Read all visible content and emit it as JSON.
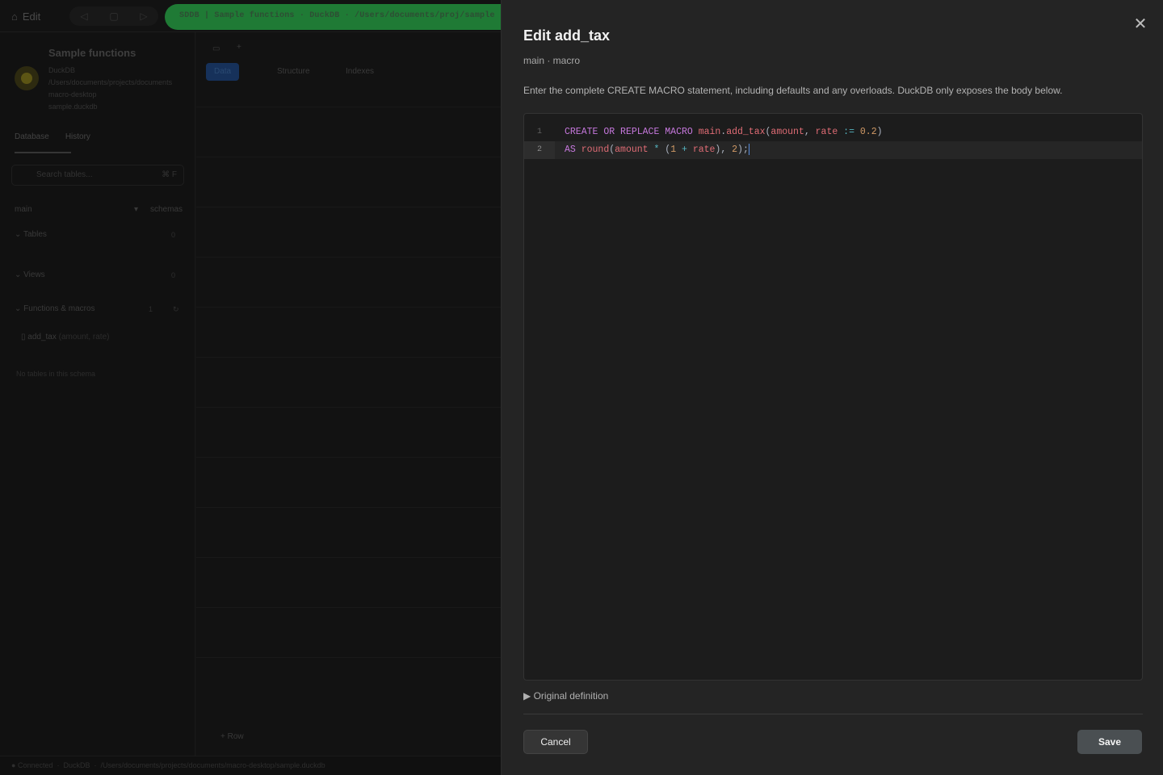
{
  "background": {
    "edit_label": "Edit",
    "pill_text": "SDDB  |  Sample functions  ·  DuckDB  ·  /Users/documents/proj/sample",
    "db": {
      "title": "Sample functions",
      "meta": [
        "DuckDB",
        "/Users/documents/projects/documents",
        "macro-desktop",
        "sample.duckdb"
      ]
    },
    "sidebar_tabs": [
      "Database",
      "History"
    ],
    "search_placeholder": "Search tables...",
    "search_shortcut": "⌘ F",
    "schema_name": "main",
    "schema_hint": "schemas",
    "groups": [
      {
        "label": "Tables",
        "count": "0"
      },
      {
        "label": "Views",
        "count": "0"
      },
      {
        "label": "Functions & macros",
        "count": "1"
      }
    ],
    "function_item": {
      "name": "add_tax",
      "args": "(amount, rate)"
    },
    "empty_note": "No tables in this schema",
    "canvas_tabs": [
      "Data",
      "Structure",
      "Indexes"
    ],
    "add_row": "+ Row",
    "status": [
      "Connected",
      "DuckDB",
      "/Users/documents/projects/documents/macro-desktop/sample.duckdb"
    ]
  },
  "dialog": {
    "title": "Edit add_tax",
    "subtitle": "main · macro",
    "description": "Enter the complete CREATE MACRO statement, including defaults and any overloads. DuckDB only exposes the body below.",
    "line_numbers": [
      "1",
      "2"
    ],
    "code_lines": [
      "CREATE OR REPLACE MACRO main.add_tax(amount, rate := 0.2)",
      "AS round(amount * (1 + rate), 2);"
    ],
    "original_definition_label": "Original definition",
    "cancel_label": "Cancel",
    "save_label": "Save",
    "close_icon": "close-icon"
  },
  "colors": {
    "panel_bg": "#242424",
    "editor_bg": "#1c1c1c",
    "keyword": "#c678dd",
    "identifier": "#e06c75",
    "number": "#d19a66",
    "operator": "#56b6c2",
    "accent_pill": "#1f7a35"
  }
}
